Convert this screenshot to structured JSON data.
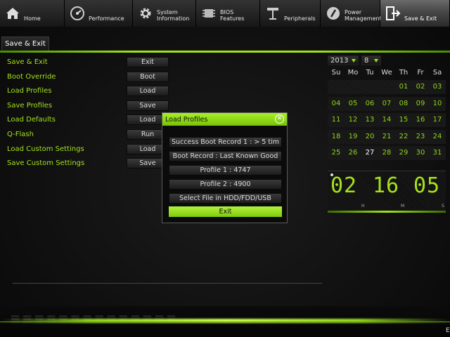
{
  "nav": {
    "tabs": [
      {
        "label": "Home",
        "icon": "house-icon"
      },
      {
        "label": "Performance",
        "icon": "gauge-icon"
      },
      {
        "label": "System\nInformation",
        "icon": "gear-icon"
      },
      {
        "label": "BIOS\nFeatures",
        "icon": "chip-icon"
      },
      {
        "label": "Peripherals",
        "icon": "plug-icon"
      },
      {
        "label": "Power\nManagement",
        "icon": "power-icon"
      },
      {
        "label": "Save & Exit",
        "icon": "exit-door-icon"
      }
    ],
    "active": "Save & Exit"
  },
  "subtab": {
    "label": "Save & Exit"
  },
  "menu": [
    {
      "label": "Save & Exit",
      "button": "Exit"
    },
    {
      "label": "Boot Override",
      "button": "Boot"
    },
    {
      "label": "Load Profiles",
      "button": "Load"
    },
    {
      "label": "Save Profiles",
      "button": "Save"
    },
    {
      "label": "Load Defaults",
      "button": "Load"
    },
    {
      "label": "Q-Flash",
      "button": "Run"
    },
    {
      "label": "Load Custom Settings",
      "button": "Load"
    },
    {
      "label": "Save Custom Settings",
      "button": "Save"
    }
  ],
  "dialog": {
    "title": "Load Profiles",
    "options": [
      "Success Boot Record 1 : > 5 tim",
      "Boot Record : Last Known Good",
      "Profile 1 : 4747",
      "Profile 2 : 4900",
      "Select File in HDD/FDD/USB"
    ],
    "exit_label": "Exit"
  },
  "calendar": {
    "year": "2013",
    "month": "8",
    "weekdays": [
      "Su",
      "Mo",
      "Tu",
      "We",
      "Th",
      "Fr",
      "Sa"
    ],
    "weeks": [
      [
        "",
        "",
        "",
        "",
        "01",
        "02",
        "03"
      ],
      [
        "04",
        "05",
        "06",
        "07",
        "08",
        "09",
        "10"
      ],
      [
        "11",
        "12",
        "13",
        "14",
        "15",
        "16",
        "17"
      ],
      [
        "18",
        "19",
        "20",
        "21",
        "22",
        "23",
        "24"
      ],
      [
        "25",
        "26",
        "27",
        "28",
        "29",
        "30",
        "31"
      ]
    ],
    "today": "27"
  },
  "clock": {
    "hours": "02",
    "minutes": "16",
    "seconds": "05",
    "h_label": "H",
    "m_label": "M",
    "s_label": "S"
  },
  "colors": {
    "accent": "#9fe31a",
    "accent_dark": "#78c208",
    "label_green": "#a6e11a"
  },
  "footer": {
    "right_text": "E"
  }
}
